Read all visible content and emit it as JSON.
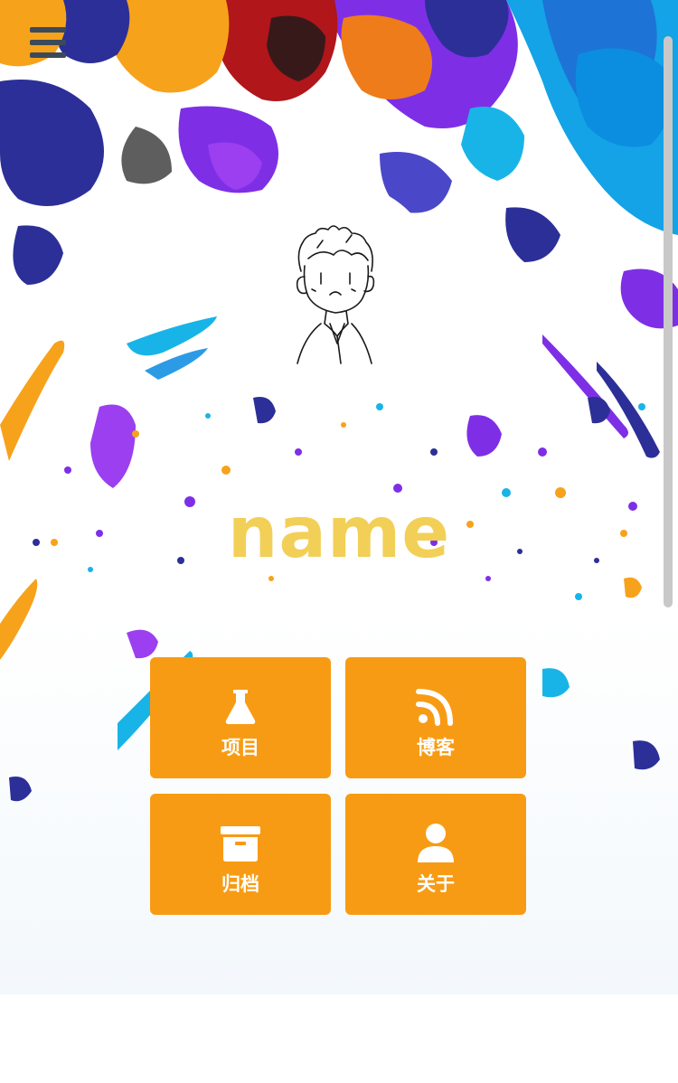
{
  "site": {
    "name": "name"
  },
  "nav": {
    "menu_icon": "hamburger-menu-icon"
  },
  "tiles": [
    {
      "label": "项目",
      "icon": "flask-icon"
    },
    {
      "label": "博客",
      "icon": "rss-icon"
    },
    {
      "label": "归档",
      "icon": "archive-box-icon"
    },
    {
      "label": "关于",
      "icon": "user-icon"
    }
  ],
  "colors": {
    "tile_background": "#f89b14",
    "name_text": "#f2cf57",
    "menu_icon": "#3b4a5a"
  }
}
